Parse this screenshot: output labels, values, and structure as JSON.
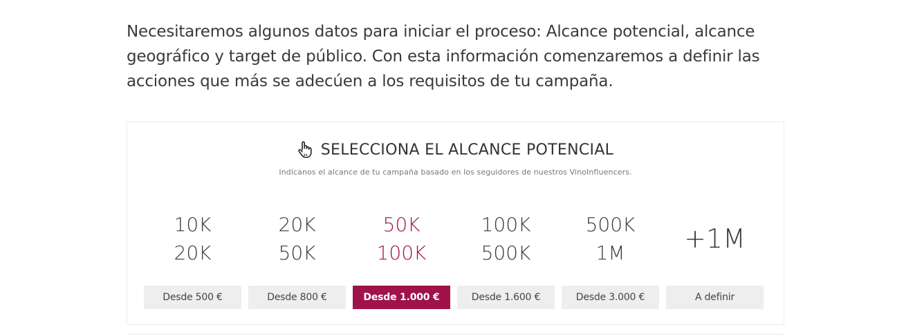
{
  "intro": {
    "text": "Necesitaremos algunos datos para iniciar el proceso: Alcance potencial, alcance geográfico y target de público. Con esta información comenzaremos a definir las acciones que más se adecúen a los requisitos de tu campaña."
  },
  "card": {
    "title": "SELECCIONA EL ALCANCE POTENCIAL",
    "subtitle": "Indícanos el alcance de tu campaña basado en los seguidores de nuestros VinoInfluencers.",
    "icon": "hand-pointer-icon",
    "accent_color": "#a0124a",
    "options": [
      {
        "from": "10K",
        "to": "20K",
        "price": "Desde 500 €"
      },
      {
        "from": "20K",
        "to": "50K",
        "price": "Desde 800 €"
      },
      {
        "from": "50K",
        "to": "100K",
        "price": "Desde 1.000 €",
        "selected": true
      },
      {
        "from": "100K",
        "to": "500K",
        "price": "Desde 1.600 €"
      },
      {
        "from": "500K",
        "to": "1M",
        "price": "Desde 3.000 €"
      },
      {
        "single": "+1M",
        "price": "A definir"
      }
    ]
  }
}
